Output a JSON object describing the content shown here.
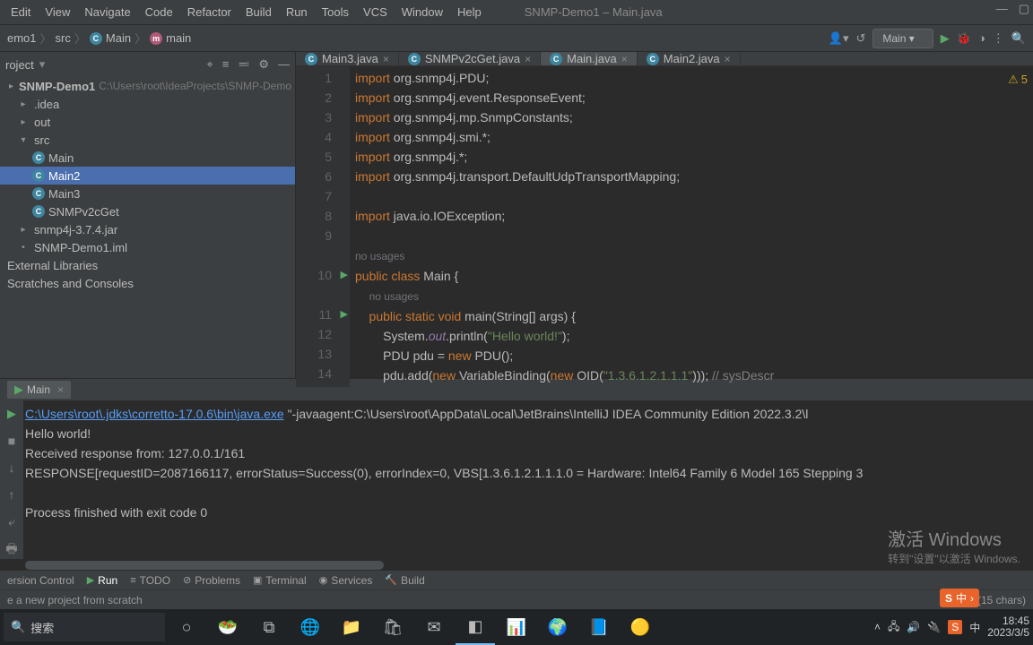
{
  "menubar": {
    "items": [
      "Edit",
      "View",
      "Navigate",
      "Code",
      "Refactor",
      "Build",
      "Run",
      "Tools",
      "VCS",
      "Window",
      "Help"
    ],
    "window_title": "SNMP-Demo1 – Main.java"
  },
  "breadcrumb": {
    "project": "emo1",
    "src": "src",
    "class": "Main",
    "method": "main"
  },
  "run_config": {
    "selected": "Main"
  },
  "project": {
    "tool_title": "roject",
    "root": "SNMP-Demo1",
    "root_path": "C:\\Users\\root\\IdeaProjects\\SNMP-Demo",
    "folders": {
      "idea": ".idea",
      "out": "out",
      "src": "src"
    },
    "classes": [
      "Main",
      "Main2",
      "Main3",
      "SNMPv2cGet"
    ],
    "files": [
      "snmp4j-3.7.4.jar",
      "SNMP-Demo1.iml"
    ],
    "extra_roots": [
      "External Libraries",
      "Scratches and Consoles"
    ],
    "selected": "Main2"
  },
  "editor": {
    "tabs": [
      {
        "name": "Main3.java",
        "active": false
      },
      {
        "name": "SNMPv2cGet.java",
        "active": false
      },
      {
        "name": "Main.java",
        "active": true
      },
      {
        "name": "Main2.java",
        "active": false
      }
    ],
    "warn_count": "5",
    "line_numbers": [
      "1",
      "2",
      "3",
      "4",
      "5",
      "6",
      "7",
      "8",
      "9",
      "",
      "10",
      "",
      "11",
      "12",
      "13",
      "14"
    ],
    "hints": {
      "no_usages": "no usages"
    },
    "code": {
      "l1a": "import ",
      "l1b": "org.snmp4j.PDU;",
      "l2a": "import ",
      "l2b": "org.snmp4j.event.ResponseEvent;",
      "l3a": "import ",
      "l3b": "org.snmp4j.mp.SnmpConstants;",
      "l4a": "import ",
      "l4b": "org.snmp4j.smi.*;",
      "l5a": "import ",
      "l5b": "org.snmp4j.*;",
      "l6a": "import ",
      "l6b": "org.snmp4j.transport.DefaultUdpTransportMapping;",
      "l8a": "import ",
      "l8b": "java.io.IOException;",
      "l10": "public class ",
      "l10b": "Main {",
      "l11": "    public static void ",
      "l11b": "main",
      "l11c": "(String[] args) {",
      "l12a": "        System.",
      "l12b": "out",
      "l12c": ".println(",
      "l12d": "\"Hello world!\"",
      "l12e": ");",
      "l13a": "        PDU pdu = ",
      "l13b": "new ",
      "l13c": "PDU();",
      "l14a": "        pdu.add(",
      "l14b": "new ",
      "l14c": "VariableBinding(",
      "l14d": "new ",
      "l14e": "OID(",
      "l14f": "\"1.3.6.1.2.1.1.1\"",
      "l14g": "))); ",
      "l14h": "// sysDescr"
    }
  },
  "run_panel": {
    "tab": "Main",
    "java_path": "C:\\Users\\root\\.jdks\\corretto-17.0.6\\bin\\java.exe",
    "java_args": " \"-javaagent:C:\\Users\\root\\AppData\\Local\\JetBrains\\IntelliJ IDEA Community Edition 2022.3.2\\l",
    "out1": "Hello world!",
    "out2": "Received response from: 127.0.0.1/161",
    "out3": "RESPONSE[requestID=2087166117, errorStatus=Success(0), errorIndex=0, VBS[1.3.6.1.2.1.1.1.0 = Hardware: Intel64 Family 6 Model 165 Stepping 3",
    "out4": "Process finished with exit code 0"
  },
  "watermark": {
    "title": "激活 Windows",
    "sub": "转到\"设置\"以激活 Windows."
  },
  "toolstrip": {
    "items": [
      "ersion Control",
      "Run",
      "TODO",
      "Problems",
      "Terminal",
      "Services",
      "Build"
    ],
    "active": "Run"
  },
  "status": {
    "left": "e a new project from scratch",
    "pos": "15:61 (15 chars)"
  },
  "taskbar": {
    "search": "搜索",
    "tray_ime": "中",
    "time": "18:45",
    "date": "2023/3/5"
  },
  "ime": {
    "icon": "S",
    "text": "中"
  }
}
